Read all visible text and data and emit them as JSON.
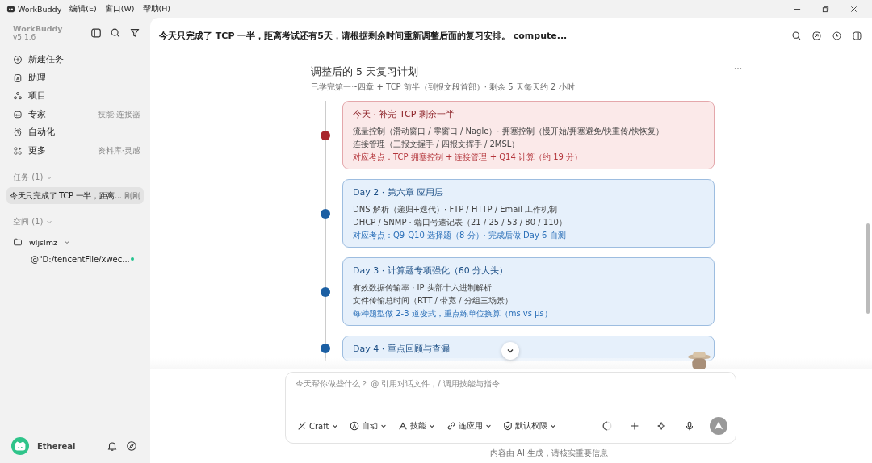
{
  "app": {
    "name": "WorkBuddy",
    "menus": [
      "编辑(E)",
      "窗口(W)",
      "帮助(H)"
    ]
  },
  "sidebar": {
    "brand": "WorkBuddy",
    "version": "v5.1.6",
    "nav": [
      {
        "kind": "new",
        "label": "新建任务"
      },
      {
        "kind": "assistant",
        "label": "助理"
      },
      {
        "kind": "project",
        "label": "项目"
      },
      {
        "kind": "expert",
        "label": "专家",
        "hint": "技能·连接器"
      },
      {
        "kind": "auto",
        "label": "自动化"
      },
      {
        "kind": "more",
        "label": "更多",
        "hint": "资料库·灵感"
      }
    ],
    "tasks": {
      "label": "任务 (1)",
      "items": [
        {
          "title": "今天只完成了 TCP 一半，距离...",
          "time": "刚刚",
          "selected": true
        }
      ]
    },
    "spaces": {
      "label": "空间 (1)",
      "items": [
        {
          "name": "wljslmz",
          "expanded": true,
          "children": [
            {
              "name": "@\"D:/tencentFile/xwec...",
              "color": "#22c38e"
            }
          ]
        }
      ]
    },
    "user": {
      "name": "Ethereal"
    }
  },
  "header": {
    "title": "今天只完成了 TCP 一半，距离考试还有5天，请根据剩余时间重新调整后面的复习安排。 compute..."
  },
  "plan": {
    "title": "调整后的 5 天复习计划",
    "subtitle": "已学完第一~四章 + TCP 前半（到报文段首部）· 剩余 5 天每天约 2 小时",
    "days": [
      {
        "kind": "today",
        "title": "今天 · 补完 TCP 剩余一半",
        "lines": [
          "流量控制（滑动窗口 / 零窗口 / Nagle）· 拥塞控制（慢开始/拥塞避免/快重传/快恢复）",
          "连接管理（三报文握手 / 四报文挥手 / 2MSL）"
        ],
        "note": "对应考点：TCP 拥塞控制 + 连接管理 + Q14 计算（约 19 分）"
      },
      {
        "kind": "day",
        "title": "Day 2 · 第六章 应用层",
        "lines": [
          "DNS 解析（递归+迭代）· FTP / HTTP / Email 工作机制",
          "DHCP / SNMP · 端口号速记表（21 / 25 / 53 / 80 / 110）"
        ],
        "note": "对应考点：Q9-Q10 选择题（8 分）· 完成后做 Day 6 自测"
      },
      {
        "kind": "day",
        "title": "Day 3 · 计算题专项强化（60 分大头）",
        "lines": [
          "有效数据传输率 · IP 头部十六进制解析",
          "文件传输总时间（RTT / 带宽 / 分组三场景）"
        ],
        "note": "每种题型做 2-3 道变式，重点练单位换算（ms vs μs）"
      },
      {
        "kind": "day",
        "title": "Day 4 · 重点回顾与查漏"
      }
    ]
  },
  "composer": {
    "placeholder": "今天帮你做些什么？ @ 引用对话文件，/ 调用技能与指令",
    "tools": [
      {
        "kind": "craft",
        "label": "Craft"
      },
      {
        "kind": "auto",
        "label": "自动"
      },
      {
        "kind": "skill",
        "label": "技能"
      },
      {
        "kind": "connect",
        "label": "连应用"
      },
      {
        "kind": "perm",
        "label": "默认权限"
      }
    ]
  },
  "footer": "内容由 AI 生成，请核实重要信息"
}
